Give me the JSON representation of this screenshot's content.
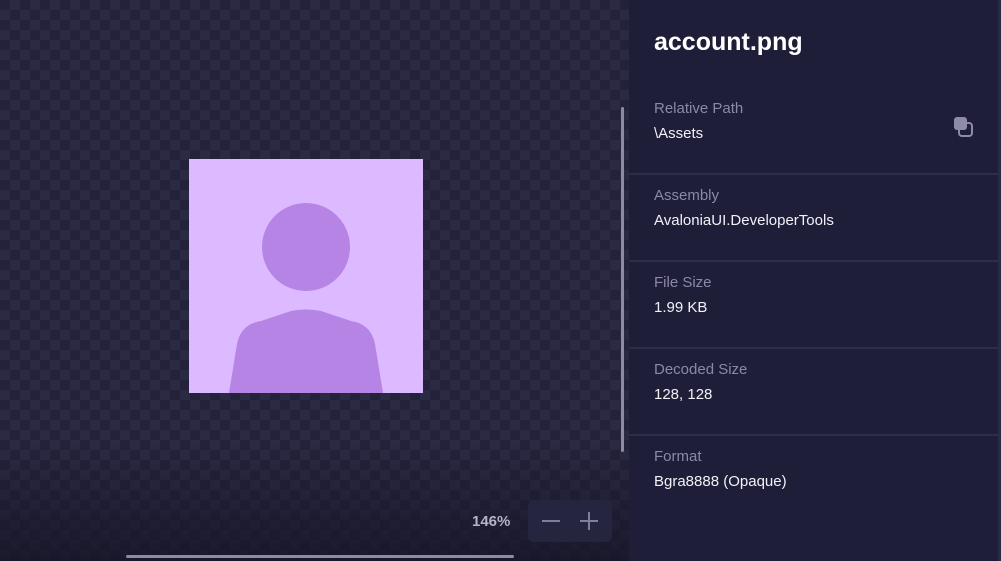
{
  "preview": {
    "zoom": "146%",
    "image_colors": {
      "background": "#ddb9ff",
      "figure": "#b584e4"
    }
  },
  "details": {
    "title": "account.png",
    "properties": [
      {
        "label": "Relative Path",
        "value": "\\Assets"
      },
      {
        "label": "Assembly",
        "value": "AvaloniaUI.DeveloperTools"
      },
      {
        "label": "File Size",
        "value": "1.99 KB"
      },
      {
        "label": "Decoded Size",
        "value": "128, 128"
      },
      {
        "label": "Format",
        "value": "Bgra8888 (Opaque)"
      }
    ]
  },
  "icons": {
    "copy": "copy-icon",
    "zoom_out": "minus-icon",
    "zoom_in": "plus-icon",
    "avatar": "person-icon"
  }
}
